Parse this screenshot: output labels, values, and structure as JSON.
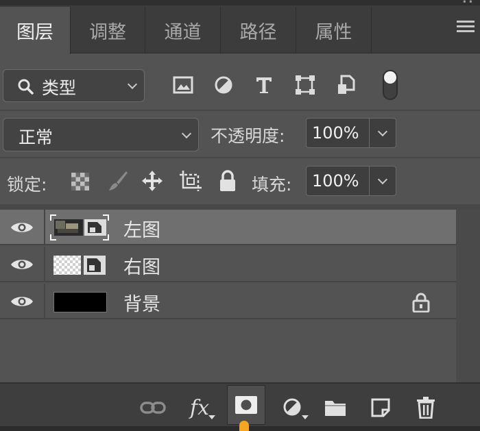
{
  "window": {
    "overflow_dots": "••"
  },
  "tabs": [
    {
      "label": "图层",
      "active": true
    },
    {
      "label": "调整",
      "active": false
    },
    {
      "label": "通道",
      "active": false
    },
    {
      "label": "路径",
      "active": false
    },
    {
      "label": "属性",
      "active": false
    }
  ],
  "filter": {
    "kind_label": "类型",
    "icons": [
      "image-filter-icon",
      "adjustment-filter-icon",
      "type-filter-icon",
      "shape-filter-icon",
      "smart-object-filter-icon",
      "filter-toggle-icon"
    ]
  },
  "blend": {
    "mode": "正常",
    "opacity_label": "不透明度:",
    "opacity_value": "100%"
  },
  "lock": {
    "label": "锁定:",
    "fill_label": "填充:",
    "fill_value": "100%",
    "icons": [
      "lock-transparent-icon",
      "lock-image-icon",
      "lock-position-icon",
      "lock-artboard-icon",
      "lock-all-icon"
    ]
  },
  "layers": [
    {
      "name": "左图",
      "visible": true,
      "selected": true,
      "type": "smart-object",
      "locked": false
    },
    {
      "name": "右图",
      "visible": true,
      "selected": false,
      "type": "smart-object",
      "locked": false
    },
    {
      "name": "背景",
      "visible": true,
      "selected": false,
      "type": "background",
      "locked": true
    }
  ],
  "bottom_toolbar": {
    "icons": [
      "link-layers-icon",
      "fx-icon",
      "add-mask-icon",
      "adjustment-layer-icon",
      "new-group-icon",
      "new-layer-icon",
      "delete-icon"
    ],
    "fx_label": "fx"
  },
  "colors": {
    "panel": "#535353",
    "tabbar": "#3c3c3c",
    "selected_row": "#6f6f6f",
    "accent": "#f5a623"
  }
}
